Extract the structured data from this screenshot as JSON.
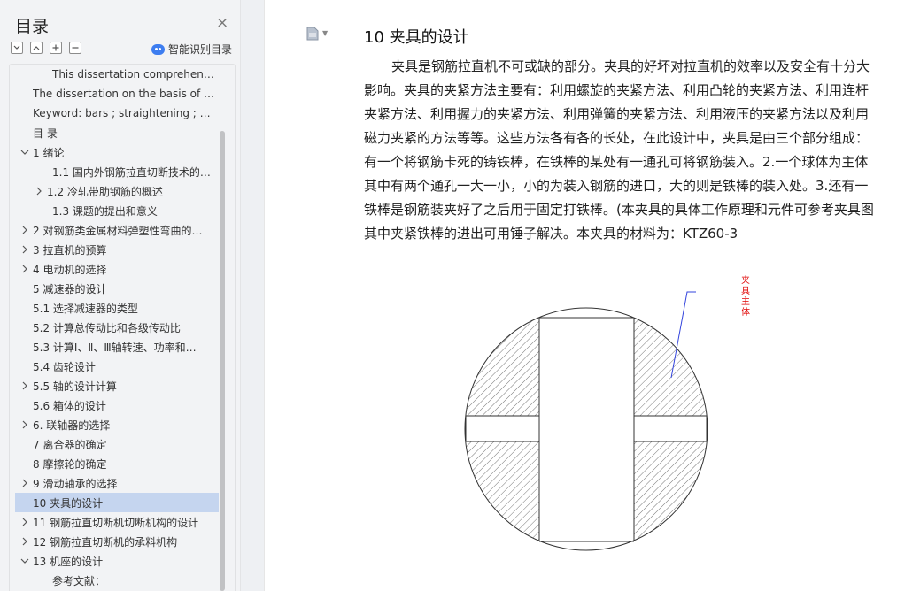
{
  "sidebar": {
    "title": "目录",
    "close_glyph": "×",
    "smart_toc_label": "智能识别目录",
    "tools": [
      "collapse-all-icon",
      "expand-all-icon",
      "add-heading-icon",
      "remove-heading-icon"
    ],
    "items": [
      {
        "label": "This dissertation comprehen…",
        "level": 2,
        "chevron": ""
      },
      {
        "label": "The dissertation on the basis of t…",
        "level": 0,
        "chevron": ""
      },
      {
        "label": "Keyword: bars ;   straightening ; …",
        "level": 0,
        "chevron": ""
      },
      {
        "label": "目  录",
        "level": 0,
        "chevron": ""
      },
      {
        "label": "1  绪论",
        "level": 0,
        "chevron": "down"
      },
      {
        "label": "1.1  国内外钢筋拉直切断技术的…",
        "level": 2,
        "chevron": ""
      },
      {
        "label": "1.2  冷轧带肋钢筋的概述",
        "level": 1,
        "chevron": "right"
      },
      {
        "label": "1.3  课题的提出和意义",
        "level": 2,
        "chevron": ""
      },
      {
        "label": "2  对钢筋类金属材料弹塑性弯曲的…",
        "level": 0,
        "chevron": "right"
      },
      {
        "label": "3  拉直机的预算",
        "level": 0,
        "chevron": "right"
      },
      {
        "label": "4  电动机的选择",
        "level": 0,
        "chevron": "right"
      },
      {
        "label": "5  减速器的设计",
        "level": 0,
        "chevron": ""
      },
      {
        "label": "5.1  选择减速器的类型",
        "level": 0,
        "chevron": ""
      },
      {
        "label": "5.2  计算总传动比和各级传动比",
        "level": 0,
        "chevron": ""
      },
      {
        "label": "5.3  计算Ⅰ、Ⅱ、Ⅲ轴转速、功率和…",
        "level": 0,
        "chevron": ""
      },
      {
        "label": "5.4  齿轮设计",
        "level": 0,
        "chevron": ""
      },
      {
        "label": "5.5  轴的设计计算",
        "level": 0,
        "chevron": "right"
      },
      {
        "label": "5.6  箱体的设计",
        "level": 0,
        "chevron": ""
      },
      {
        "label": "6.  联轴器的选择",
        "level": 0,
        "chevron": "right"
      },
      {
        "label": "7  离合器的确定",
        "level": 0,
        "chevron": ""
      },
      {
        "label": "8  摩擦轮的确定",
        "level": 0,
        "chevron": ""
      },
      {
        "label": "9  滑动轴承的选择",
        "level": 0,
        "chevron": "right"
      },
      {
        "label": "10  夹具的设计",
        "level": 0,
        "chevron": "",
        "active": true
      },
      {
        "label": "11  钢筋拉直切断机切断机构的设计",
        "level": 0,
        "chevron": "right"
      },
      {
        "label": "12  钢筋拉直切断机的承料机构",
        "level": 0,
        "chevron": "right"
      },
      {
        "label": "13  机座的设计",
        "level": 0,
        "chevron": "down"
      },
      {
        "label": "参考文献：",
        "level": 2,
        "chevron": ""
      }
    ]
  },
  "document": {
    "heading": "10  夹具的设计",
    "paragraph_lines": [
      "夹具是钢筋拉直机不可或缺的部分。夹具的好坏对拉直机的效率以及安全有十分大",
      "影响。夹具的夹紧方法主要有：利用螺旋的夹紧方法、利用凸轮的夹紧方法、利用连杆",
      "夹紧方法、利用握力的夹紧方法、利用弹簧的夹紧方法、利用液压的夹紧方法以及利用",
      "磁力夹紧的方法等等。这些方法各有各的长处，在此设计中，夹具是由三个部分组成：",
      "有一个将钢筋卡死的铸铁棒，在铁棒的某处有一通孔可将钢筋装入。2.一个球体为主体",
      "其中有两个通孔一大一小，小的为装入钢筋的进口，大的则是铁棒的装入处。3.还有一",
      "铁棒是钢筋装夹好了之后用于固定打铁棒。(本夹具的具体工作原理和元件可参考夹具图",
      "其中夹紧铁棒的进出可用锤子解决。本夹具的材料为：KTZ60-3"
    ],
    "drawing_callout": "夹具主体"
  }
}
